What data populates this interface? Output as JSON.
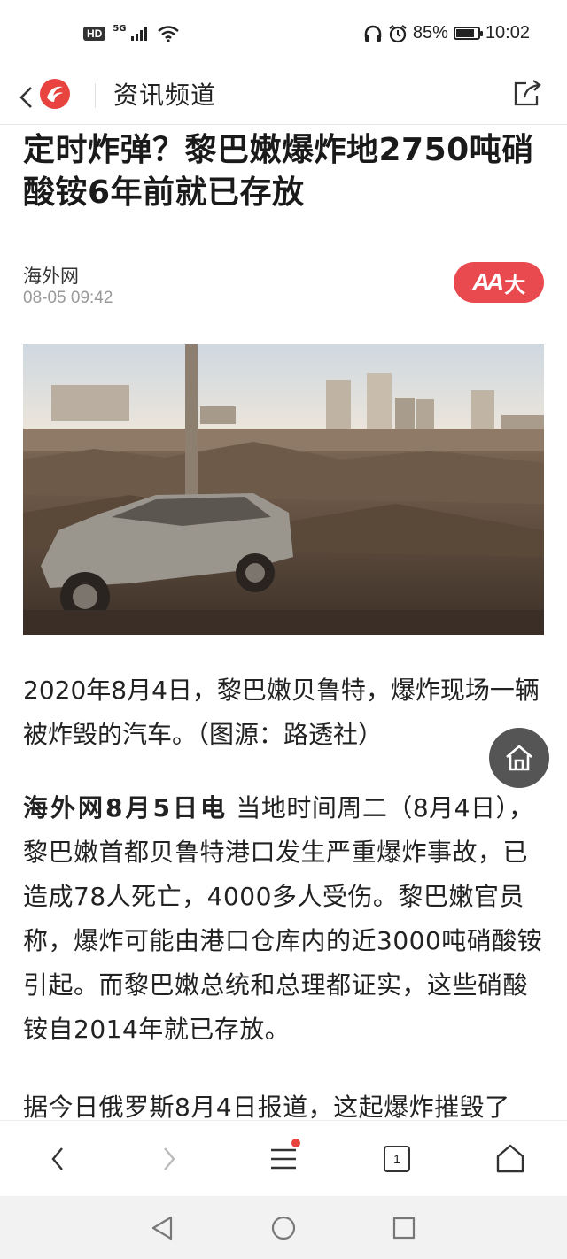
{
  "status_bar": {
    "hd": "HD",
    "network": "5G",
    "battery": "85%",
    "battery_level": 0.85,
    "time": "10:02",
    "icons": [
      "signal-icon",
      "wifi-icon",
      "headphones-icon",
      "alarm-icon",
      "battery-icon"
    ]
  },
  "top_nav": {
    "title": "资讯频道",
    "back_icon": "chevron-left-icon",
    "logo_icon": "ifeng-logo-icon",
    "share_icon": "share-icon"
  },
  "article": {
    "headline": "定时炸弹？黎巴嫩爆炸地2750吨硝酸铵6年前就已存放",
    "source": "海外网",
    "time": "08-05 09:42",
    "font_size_button": "大",
    "font_size_glyph": "AA",
    "image_caption": "2020年8月4日，黎巴嫩贝鲁特，爆炸现场一辆被炸毁的汽车。（图源：路透社）",
    "paragraph1_lead": "海外网8月5日电",
    "paragraph1_text": " 当地时间周二（8月4日），黎巴嫩首都贝鲁特港口发生严重爆炸事故，已造成78人死亡，4000多人受伤。黎巴嫩官员称，爆炸可能由港口仓库内的近3000吨硝酸铵引起。而黎巴嫩总统和总理都证实，这些硝酸铵自2014年就已存放。",
    "paragraph2_text": "据今日俄罗斯8月4日报道，这起爆炸摧毁了"
  },
  "browser_bar": {
    "tab_count": "1",
    "items": [
      "back-icon",
      "forward-icon",
      "menu-icon",
      "tabs-icon",
      "home-icon"
    ]
  },
  "colors": {
    "accent": "#e84a4f",
    "notify_dot": "#e8433f",
    "fab": "#555555"
  }
}
